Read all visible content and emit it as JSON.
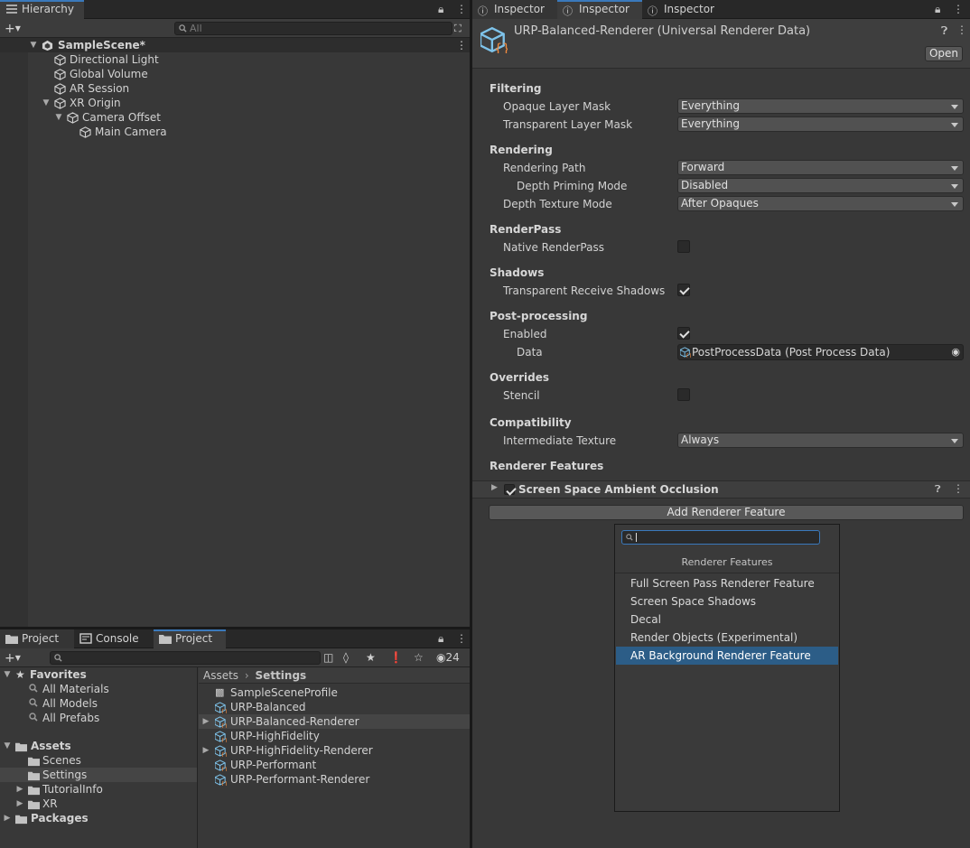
{
  "hierarchy": {
    "tab": "Hierarchy",
    "search_placeholder": "All",
    "scene": "SampleScene*",
    "items": [
      {
        "label": "Directional Light"
      },
      {
        "label": "Global Volume"
      },
      {
        "label": "AR Session"
      },
      {
        "label": "XR Origin"
      },
      {
        "label": "Camera Offset"
      },
      {
        "label": "Main Camera"
      }
    ]
  },
  "inspector": {
    "tabs": [
      "Inspector",
      "Inspector",
      "Inspector"
    ],
    "title": "URP-Balanced-Renderer (Universal Renderer Data)",
    "open_label": "Open",
    "sections": {
      "filtering": "Filtering",
      "rendering": "Rendering",
      "renderpass": "RenderPass",
      "shadows": "Shadows",
      "postprocessing": "Post-processing",
      "overrides": "Overrides",
      "compatibility": "Compatibility",
      "renderer_features": "Renderer Features"
    },
    "fields": {
      "opaque_layer_mask": {
        "label": "Opaque Layer Mask",
        "value": "Everything"
      },
      "transparent_layer_mask": {
        "label": "Transparent Layer Mask",
        "value": "Everything"
      },
      "rendering_path": {
        "label": "Rendering Path",
        "value": "Forward"
      },
      "depth_priming_mode": {
        "label": "Depth Priming Mode",
        "value": "Disabled"
      },
      "depth_texture_mode": {
        "label": "Depth Texture Mode",
        "value": "After Opaques"
      },
      "native_renderpass": {
        "label": "Native RenderPass",
        "checked": false
      },
      "transparent_receive_shadows": {
        "label": "Transparent Receive Shadows",
        "checked": true
      },
      "pp_enabled": {
        "label": "Enabled",
        "checked": true
      },
      "pp_data": {
        "label": "Data",
        "value": "PostProcessData (Post Process Data)"
      },
      "stencil": {
        "label": "Stencil",
        "checked": false
      },
      "intermediate_texture": {
        "label": "Intermediate Texture",
        "value": "Always"
      }
    },
    "feature": {
      "label": "Screen Space Ambient Occlusion",
      "enabled": true
    },
    "add_feature_label": "Add Renderer Feature"
  },
  "feature_popup": {
    "header": "Renderer Features",
    "search_value": "",
    "items": [
      {
        "label": "Full Screen Pass Renderer Feature"
      },
      {
        "label": "Screen Space Shadows"
      },
      {
        "label": "Decal"
      },
      {
        "label": "Render Objects (Experimental)"
      },
      {
        "label": "AR Background Renderer Feature"
      }
    ]
  },
  "project": {
    "tabs": [
      "Project",
      "Console",
      "Project"
    ],
    "visibility_count": "24",
    "favorites": {
      "label": "Favorites",
      "items": [
        "All Materials",
        "All Models",
        "All Prefabs"
      ]
    },
    "assets": {
      "label": "Assets",
      "items": [
        "Scenes",
        "Settings",
        "TutorialInfo",
        "XR"
      ]
    },
    "packages": "Packages",
    "breadcrumb": {
      "root": "Assets",
      "current": "Settings"
    },
    "files": [
      "SampleSceneProfile",
      "URP-Balanced",
      "URP-Balanced-Renderer",
      "URP-HighFidelity",
      "URP-HighFidelity-Renderer",
      "URP-Performant",
      "URP-Performant-Renderer"
    ]
  },
  "colors": {
    "accent": "#3a79bb",
    "selection": "#2c5d87",
    "panel": "#383838"
  }
}
